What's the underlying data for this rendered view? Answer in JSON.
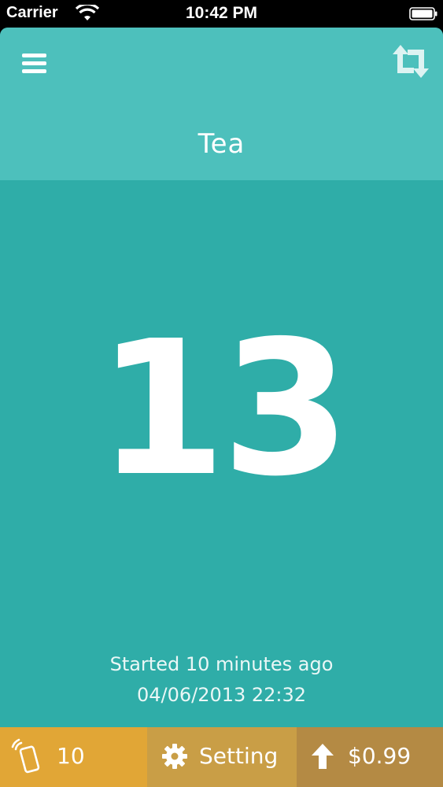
{
  "status_bar": {
    "carrier": "Carrier",
    "time": "10:42 PM",
    "icons": [
      "wifi-icon",
      "battery-icon"
    ]
  },
  "header": {
    "title": "Tea",
    "icons": [
      "menu-icon",
      "repeat-icon"
    ]
  },
  "counter": {
    "value": "13"
  },
  "info": {
    "started_text": "Started 10 minutes ago",
    "started_date": "04/06/2013 22:32"
  },
  "bottom_bar": {
    "vibrate": {
      "icon": "vibrate-phone-icon",
      "label": "10"
    },
    "setting": {
      "icon": "gear-icon",
      "label": "Setting"
    },
    "upgrade": {
      "icon": "arrow-up-icon",
      "label": "$0.99"
    }
  },
  "colors": {
    "header_bg": "#4dc0bc",
    "main_bg": "#2fada8",
    "vibrate_bg": "#e1a636",
    "setting_bg": "#c99e46",
    "upgrade_bg": "#b48a44"
  }
}
